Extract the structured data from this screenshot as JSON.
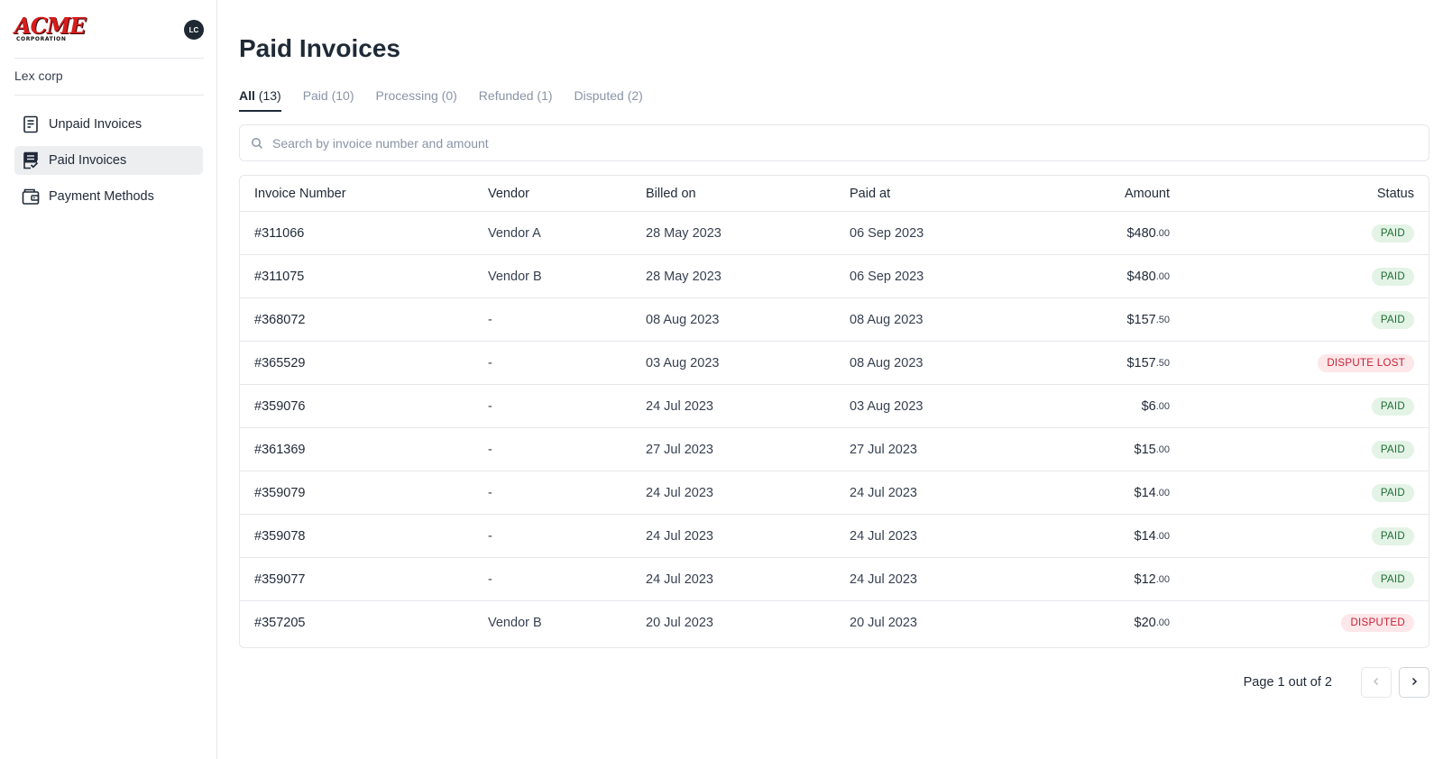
{
  "app": {
    "logo_text": "ACME",
    "logo_subtext": "CORPORATION",
    "avatar_initials": "LC",
    "org_name": "Lex corp"
  },
  "sidebar": {
    "items": [
      {
        "label": "Unpaid Invoices",
        "icon": "receipt-icon",
        "active": false
      },
      {
        "label": "Paid Invoices",
        "icon": "receipt-check-icon",
        "active": true
      },
      {
        "label": "Payment Methods",
        "icon": "wallet-icon",
        "active": false
      }
    ]
  },
  "page": {
    "title": "Paid Invoices"
  },
  "tabs": [
    {
      "label": "All",
      "count": "(13)",
      "active": true
    },
    {
      "label": "Paid",
      "count": "(10)",
      "active": false
    },
    {
      "label": "Processing",
      "count": "(0)",
      "active": false
    },
    {
      "label": "Refunded",
      "count": "(1)",
      "active": false
    },
    {
      "label": "Disputed",
      "count": "(2)",
      "active": false
    }
  ],
  "search": {
    "placeholder": "Search by invoice number and amount",
    "value": ""
  },
  "table": {
    "columns": {
      "invoice": "Invoice Number",
      "vendor": "Vendor",
      "billed": "Billed on",
      "paid": "Paid at",
      "amount": "Amount",
      "status": "Status"
    },
    "rows": [
      {
        "invoice": "#311066",
        "vendor": "Vendor A",
        "billed": "28 May 2023",
        "paid": "06 Sep 2023",
        "amount": "$480",
        "cents": ".00",
        "status": "PAID",
        "status_type": "paid"
      },
      {
        "invoice": "#311075",
        "vendor": "Vendor B",
        "billed": "28 May 2023",
        "paid": "06 Sep 2023",
        "amount": "$480",
        "cents": ".00",
        "status": "PAID",
        "status_type": "paid"
      },
      {
        "invoice": "#368072",
        "vendor": "-",
        "billed": "08 Aug 2023",
        "paid": "08 Aug 2023",
        "amount": "$157",
        "cents": ".50",
        "status": "PAID",
        "status_type": "paid"
      },
      {
        "invoice": "#365529",
        "vendor": "-",
        "billed": "03 Aug 2023",
        "paid": "08 Aug 2023",
        "amount": "$157",
        "cents": ".50",
        "status": "DISPUTE LOST",
        "status_type": "red"
      },
      {
        "invoice": "#359076",
        "vendor": "-",
        "billed": "24 Jul 2023",
        "paid": "03 Aug 2023",
        "amount": "$6",
        "cents": ".00",
        "status": "PAID",
        "status_type": "paid"
      },
      {
        "invoice": "#361369",
        "vendor": "-",
        "billed": "27 Jul 2023",
        "paid": "27 Jul 2023",
        "amount": "$15",
        "cents": ".00",
        "status": "PAID",
        "status_type": "paid"
      },
      {
        "invoice": "#359079",
        "vendor": "-",
        "billed": "24 Jul 2023",
        "paid": "24 Jul 2023",
        "amount": "$14",
        "cents": ".00",
        "status": "PAID",
        "status_type": "paid"
      },
      {
        "invoice": "#359078",
        "vendor": "-",
        "billed": "24 Jul 2023",
        "paid": "24 Jul 2023",
        "amount": "$14",
        "cents": ".00",
        "status": "PAID",
        "status_type": "paid"
      },
      {
        "invoice": "#359077",
        "vendor": "-",
        "billed": "24 Jul 2023",
        "paid": "24 Jul 2023",
        "amount": "$12",
        "cents": ".00",
        "status": "PAID",
        "status_type": "paid"
      },
      {
        "invoice": "#357205",
        "vendor": "Vendor B",
        "billed": "20 Jul 2023",
        "paid": "20 Jul 2023",
        "amount": "$20",
        "cents": ".00",
        "status": "DISPUTED",
        "status_type": "red"
      }
    ]
  },
  "pagination": {
    "text": "Page 1 out of 2",
    "prev_icon": "chevron-left-icon",
    "next_icon": "chevron-right-icon"
  },
  "colors": {
    "active_tab": "#1f2a37",
    "paid_badge_bg": "#e3f3e6",
    "paid_badge_text": "#1e6b34",
    "dispute_badge_bg": "#fde7e9",
    "dispute_badge_text": "#c81e33",
    "brand_red": "#d91c1c"
  }
}
